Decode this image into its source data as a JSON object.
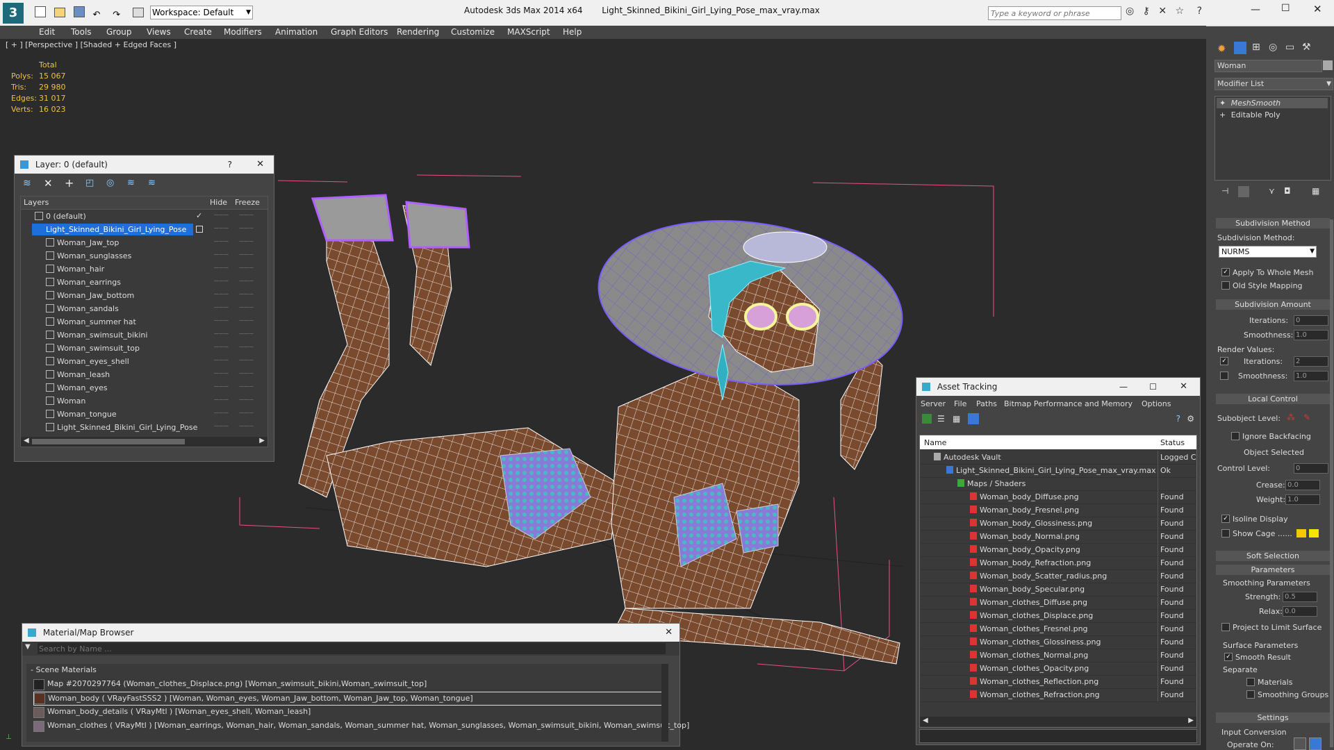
{
  "titlebar": {
    "app": "Autodesk 3ds Max  2014 x64",
    "file": "Light_Skinned_Bikini_Girl_Lying_Pose_max_vray.max",
    "workspace": "Workspace: Default",
    "search_placeholder": "Type a keyword or phrase"
  },
  "menu": [
    "Edit",
    "Tools",
    "Group",
    "Views",
    "Create",
    "Modifiers",
    "Animation",
    "Graph Editors",
    "Rendering",
    "Customize",
    "MAXScript",
    "Help"
  ],
  "viewport": {
    "label": "[ + ] [Perspective ] [Shaded + Edged Faces ]",
    "stats_header": "Total",
    "stats": [
      {
        "label": "Polys:",
        "value": "15 067"
      },
      {
        "label": "Tris:",
        "value": "29 980"
      },
      {
        "label": "Edges:",
        "value": "31 017"
      },
      {
        "label": "Verts:",
        "value": "16 023"
      }
    ]
  },
  "layer_window": {
    "title": "Layer: 0 (default)",
    "col_layers": "Layers",
    "col_hide": "Hide",
    "col_freeze": "Freeze",
    "rows": [
      "0 (default)",
      "Light_Skinned_Bikini_Girl_Lying_Pose",
      "Woman_Jaw_top",
      "Woman_sunglasses",
      "Woman_hair",
      "Woman_earrings",
      "Woman_Jaw_bottom",
      "Woman_sandals",
      "Woman_summer hat",
      "Woman_swimsuit_bikini",
      "Woman_swimsuit_top",
      "Woman_eyes_shell",
      "Woman_leash",
      "Woman_eyes",
      "Woman",
      "Woman_tongue",
      "Light_Skinned_Bikini_Girl_Lying_Pose"
    ]
  },
  "material_browser": {
    "title": "Material/Map Browser",
    "search_placeholder": "Search by Name ...",
    "group": "- Scene Materials",
    "items": [
      "Map #2070297764 (Woman_clothes_Displace.png) [Woman_swimsuit_bikini,Woman_swimsuit_top]",
      "Woman_body  ( VRayFastSSS2 ) [Woman, Woman_eyes, Woman_Jaw_bottom, Woman_Jaw_top, Woman_tongue]",
      "Woman_body_details  ( VRayMtl ) [Woman_eyes_shell, Woman_leash]",
      "Woman_clothes  ( VRayMtl ) [Woman_earrings, Woman_hair, Woman_sandals, Woman_summer hat, Woman_sunglasses, Woman_swimsuit_bikini, Woman_swimsuit_top]"
    ]
  },
  "asset_tracking": {
    "title": "Asset Tracking",
    "menu": [
      "Server",
      "File",
      "Paths",
      "Bitmap Performance and Memory",
      "Options"
    ],
    "col_name": "Name",
    "col_status": "Status",
    "rows": [
      {
        "name": "Autodesk Vault",
        "status": "Logged C",
        "indent": 0
      },
      {
        "name": "Light_Skinned_Bikini_Girl_Lying_Pose_max_vray.max",
        "status": "Ok",
        "indent": 1
      },
      {
        "name": "Maps / Shaders",
        "status": "",
        "indent": 2
      },
      {
        "name": "Woman_body_Diffuse.png",
        "status": "Found",
        "indent": 3
      },
      {
        "name": "Woman_body_Fresnel.png",
        "status": "Found",
        "indent": 3
      },
      {
        "name": "Woman_body_Glossiness.png",
        "status": "Found",
        "indent": 3
      },
      {
        "name": "Woman_body_Normal.png",
        "status": "Found",
        "indent": 3
      },
      {
        "name": "Woman_body_Opacity.png",
        "status": "Found",
        "indent": 3
      },
      {
        "name": "Woman_body_Refraction.png",
        "status": "Found",
        "indent": 3
      },
      {
        "name": "Woman_body_Scatter_radius.png",
        "status": "Found",
        "indent": 3
      },
      {
        "name": "Woman_body_Specular.png",
        "status": "Found",
        "indent": 3
      },
      {
        "name": "Woman_clothes_Diffuse.png",
        "status": "Found",
        "indent": 3
      },
      {
        "name": "Woman_clothes_Displace.png",
        "status": "Found",
        "indent": 3
      },
      {
        "name": "Woman_clothes_Fresnel.png",
        "status": "Found",
        "indent": 3
      },
      {
        "name": "Woman_clothes_Glossiness.png",
        "status": "Found",
        "indent": 3
      },
      {
        "name": "Woman_clothes_Normal.png",
        "status": "Found",
        "indent": 3
      },
      {
        "name": "Woman_clothes_Opacity.png",
        "status": "Found",
        "indent": 3
      },
      {
        "name": "Woman_clothes_Reflection.png",
        "status": "Found",
        "indent": 3
      },
      {
        "name": "Woman_clothes_Refraction.png",
        "status": "Found",
        "indent": 3
      }
    ]
  },
  "command_panel": {
    "object_name": "Woman",
    "modifier_list": "Modifier List",
    "stack": [
      "MeshSmooth",
      "Editable Poly"
    ],
    "subdivision_method_header": "Subdivision Method",
    "subdivision_method_label": "Subdivision Method:",
    "subdivision_method_value": "NURMS",
    "apply_whole_mesh": "Apply To Whole Mesh",
    "old_style_mapping": "Old Style Mapping",
    "subdivision_amount_header": "Subdivision Amount",
    "iterations_label": "Iterations:",
    "iterations_value": "0",
    "smoothness_label": "Smoothness:",
    "smoothness_value": "1.0",
    "render_values_label": "Render Values:",
    "render_iterations_value": "2",
    "render_smoothness_value": "1.0",
    "local_control_header": "Local Control",
    "subobject_level": "Subobject Level:",
    "ignore_backfacing": "Ignore Backfacing",
    "object_selected": "Object Selected",
    "control_level": "Control Level:",
    "control_level_value": "0",
    "crease_label": "Crease:",
    "crease_value": "0.0",
    "weight_label": "Weight:",
    "weight_value": "1.0",
    "isoline_display": "Isoline Display",
    "show_cage": "Show Cage ......",
    "soft_selection_header": "Soft Selection",
    "parameters_header": "Parameters",
    "smoothing_parameters": "Smoothing Parameters",
    "strength_label": "Strength:",
    "strength_value": "0.5",
    "relax_label": "Relax:",
    "relax_value": "0.0",
    "project_limit_surface": "Project to Limit Surface",
    "surface_parameters": "Surface Parameters",
    "smooth_result": "Smooth Result",
    "separate": "Separate",
    "materials": "Materials",
    "smoothing_groups": "Smoothing Groups",
    "settings_header": "Settings",
    "input_conversion": "Input Conversion",
    "operate_on": "Operate On:"
  },
  "colors": {
    "viewport_bg": "#2b2b2b",
    "panel_bg": "#444444",
    "stat_text": "#f0c040",
    "selection": "#1e6fd9",
    "skin": "#7a4a2e",
    "wire": "#ffffff",
    "hat": "#8a8a8a",
    "bbox": "#e8508a",
    "cage_yellow": "#f5c800"
  }
}
